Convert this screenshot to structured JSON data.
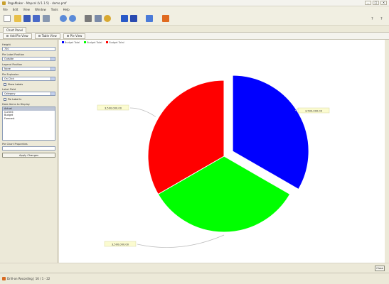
{
  "window": {
    "title": "PageMaker - Mapcel (V.1.1.5) - demo.pmf",
    "controls": [
      "_",
      "□",
      "✕"
    ]
  },
  "menu": [
    "File",
    "Edit",
    "View",
    "Window",
    "Tools",
    "Help"
  ],
  "toolbar": {
    "icons": [
      "new-icon",
      "open-icon",
      "save-icon",
      "save-as-icon",
      "print-icon",
      "undo-icon",
      "redo-icon",
      "cut-icon",
      "copy-icon",
      "paste-icon",
      "chart-icon",
      "chart-alt-icon",
      "wizard-icon",
      "alert-icon"
    ],
    "right_icons": [
      "?",
      "?"
    ]
  },
  "main_tab": {
    "label": "Chart Panel"
  },
  "subtabs": [
    {
      "label": "Add Pie View"
    },
    {
      "label": "Table View"
    },
    {
      "label": "Pie View"
    }
  ],
  "left_panel": {
    "fields": [
      {
        "label": "Height",
        "value": "700",
        "type": "text"
      },
      {
        "label": "Pie Label Position",
        "value": "Outside",
        "type": "select"
      },
      {
        "label": "Legend Position",
        "value": "None",
        "type": "select"
      },
      {
        "label": "Pie Explosion",
        "value": "On Click",
        "type": "select"
      }
    ],
    "checkbox_1": {
      "label": "Show Labels"
    },
    "label_field": {
      "label": "Label Field",
      "value": "Category",
      "type": "select"
    },
    "checkbox_2": {
      "label": "Pie Label In"
    },
    "list": {
      "label": "Data Items to Display",
      "items": [
        "Actual",
        "Current",
        "Budget",
        "Forecast"
      ],
      "selected_index": 0
    },
    "last_label": "Pie Chart Properties",
    "button_label": "Apply Changes"
  },
  "legend": {
    "entries": [
      {
        "label": "Budget Total",
        "color": "#0000ff"
      },
      {
        "label": "Budget Total",
        "color": "#00ff00"
      },
      {
        "label": "Budget Total",
        "color": "#ff0000"
      }
    ]
  },
  "chart_data": {
    "type": "pie",
    "slices": [
      {
        "label": "3,500,000.00",
        "value": 3500000,
        "color": "#0000ff",
        "exploded": true
      },
      {
        "label": "3,500,000.00",
        "value": 3500000,
        "color": "#00ff00",
        "exploded": false
      },
      {
        "label": "3,500,000.00",
        "value": 3500000,
        "color": "#ff0000",
        "exploded": false
      }
    ],
    "title": "",
    "legend_position": "top-left"
  },
  "bottom": {
    "ok_label": "Close"
  },
  "status": {
    "text": "Drill-on Recording | 16 / 1 - 22"
  }
}
